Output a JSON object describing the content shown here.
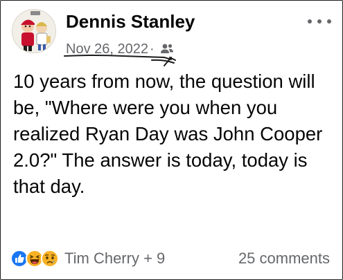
{
  "post": {
    "author": "Dennis Stanley",
    "date": "Nov 26, 2022",
    "separator": "·",
    "audience_icon": "friends-icon",
    "message": "10 years from now, the question will be, \"Where were you when you realized Ryan Day was John Cooper 2.0?\" The answer is today, today is that day.",
    "reactions": {
      "icons": [
        "like-reaction-icon",
        "haha-reaction-icon",
        "sad-reaction-icon"
      ],
      "names": "Tim Cherry + 9"
    },
    "comments": "25 comments"
  },
  "colors": {
    "like": "#1877f2",
    "reaction_yellow": "#f7b125",
    "secondary_text": "#65676b",
    "annotation": "#1a1a1a"
  }
}
